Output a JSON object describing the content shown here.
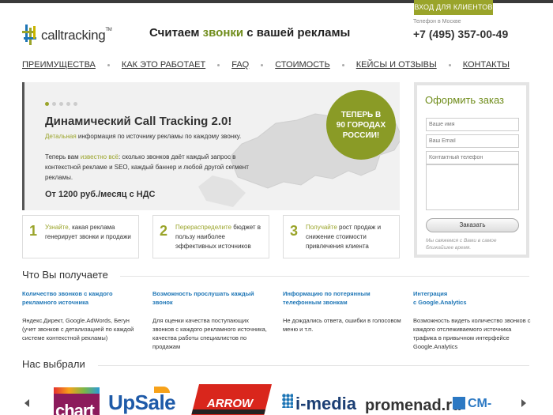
{
  "header": {
    "client_button": "ВХОД ДЛЯ КЛИЕНТОВ",
    "logo_text": "calltracking",
    "logo_tm": "TM",
    "slogan_part1": "Считаем ",
    "slogan_accent": "звонки",
    "slogan_part2": " с вашей рекламы",
    "phone_label": "Телефон в Москве",
    "phone": "+7 (495) 357-00-49"
  },
  "nav": {
    "items": [
      "ПРЕИМУЩЕСТВА",
      "КАК ЭТО РАБОТАЕТ",
      "FAQ",
      "СТОИМОСТЬ",
      "КЕЙСЫ И ОТЗЫВЫ",
      "КОНТАКТЫ"
    ]
  },
  "hero": {
    "title": "Динамический Call Tracking 2.0!",
    "sub_highlight": "Детальная",
    "sub_rest": " информация по источнику рекламы по каждому звонку.",
    "text_part1": "Теперь вам ",
    "text_highlight": "известно всё",
    "text_part2": ": сколько звонков даёт каждый запрос в контекстной рекламе и SEO, каждый баннер и любой другой сегмент рекламы.",
    "price": "От 1200 руб./месяц с НДС",
    "badge_line1": "ТЕПЕРЬ В",
    "badge_line2": "90 ГОРОДАХ",
    "badge_line3": "РОССИИ!"
  },
  "order_form": {
    "title": "Оформить заказ",
    "name_placeholder": "Ваше имя",
    "email_placeholder": "Ваш Email",
    "phone_placeholder": "Контактный телефон",
    "submit_label": "Заказать",
    "note": "Мы свяжемся с Вами в самое ближайшее время."
  },
  "steps": [
    {
      "num": "1",
      "highlight": "Узнайте,",
      "rest": " какая реклама генерирует звонки и продажи"
    },
    {
      "num": "2",
      "highlight": "Перераспределите",
      "rest": " бюджет в пользу наиболее эффективных источников"
    },
    {
      "num": "3",
      "highlight": "Получайте",
      "rest": " рост продаж и снижение стоимости привлечения клиента"
    }
  ],
  "benefits_section": {
    "title": "Что Вы получаете",
    "items": [
      {
        "title": "Количество звонков с каждого рекламного источника",
        "desc": "Яндекс.Директ, Google.AdWords, Бегун (учет звонков с детализацией по каждой системе контекстной рекламы)"
      },
      {
        "title": "Возможность прослушать каждый звонок",
        "desc": "Для оценки качества поступающих звонков с каждого рекламного источника, качества работы специалистов по продажам"
      },
      {
        "title": "Информацию по потерянным телефонным звонкам",
        "desc": "Не дождались ответа, ошибки в голосовом меню и т.п."
      },
      {
        "title_line1": "Интеграция",
        "title_line2": "с Google.Analytics",
        "desc": "Возможность видеть количество звонков с каждого отслеживаемого источника трафика в привычном интерфейсе Google.Analytics"
      }
    ]
  },
  "clients_section": {
    "title": "Нас выбрали",
    "logos": [
      "chart",
      "UpSale",
      "ARROW",
      "i-media",
      "promenad.ru",
      "CM-"
    ]
  },
  "colors": {
    "accent_green": "#9aa42a",
    "link_blue": "#1e76b6"
  }
}
